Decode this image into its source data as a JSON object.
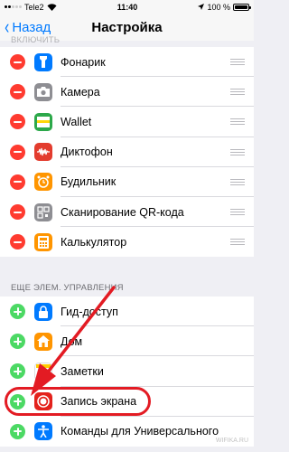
{
  "status_bar": {
    "carrier": "Tele2",
    "time": "11:40",
    "battery_percent": "100 %"
  },
  "nav": {
    "back_label": "Назад",
    "title": "Настройка"
  },
  "included_section": {
    "header": "ВКЛЮЧИТЬ",
    "items": [
      {
        "label": "Фонарик",
        "icon": "flashlight-icon",
        "color": "#007aff"
      },
      {
        "label": "Камера",
        "icon": "camera-icon",
        "color": "#8e8e93"
      },
      {
        "label": "Wallet",
        "icon": "wallet-icon",
        "color": "#2ca84a"
      },
      {
        "label": "Диктофон",
        "icon": "voice-memo-icon",
        "color": "#e33c2e"
      },
      {
        "label": "Будильник",
        "icon": "alarm-clock-icon",
        "color": "#ff9500"
      },
      {
        "label": "Сканирование QR-кода",
        "icon": "qr-code-icon",
        "color": "#8e8e93"
      },
      {
        "label": "Калькулятор",
        "icon": "calculator-icon",
        "color": "#ff9500"
      }
    ]
  },
  "more_section": {
    "header": "ЕЩЕ ЭЛЕМ. УПРАВЛЕНИЯ",
    "items": [
      {
        "label": "Гид-доступ",
        "icon": "guided-access-icon",
        "color": "#007aff"
      },
      {
        "label": "Дом",
        "icon": "home-icon",
        "color": "#ff9500"
      },
      {
        "label": "Заметки",
        "icon": "notes-icon",
        "color": "#ffcc00"
      },
      {
        "label": "Запись экрана",
        "icon": "screen-recording-icon",
        "color": "#e3221c"
      },
      {
        "label": "Команды для Универсального",
        "icon": "accessibility-icon",
        "color": "#007aff"
      }
    ]
  },
  "watermark": "WIFIKA.RU",
  "colors": {
    "accent": "#007aff",
    "remove": "#ff3b30",
    "add": "#4cd964",
    "annotation": "#e31b23"
  }
}
